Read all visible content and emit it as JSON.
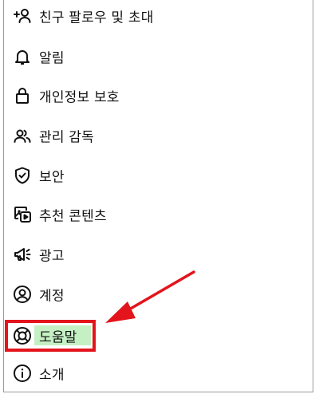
{
  "menu": {
    "items": [
      {
        "label": "친구 팔로우 및 초대",
        "icon": "add-person-icon"
      },
      {
        "label": "알림",
        "icon": "bell-icon"
      },
      {
        "label": "개인정보 보호",
        "icon": "lock-icon"
      },
      {
        "label": "관리 감독",
        "icon": "people-icon"
      },
      {
        "label": "보안",
        "icon": "shield-check-icon"
      },
      {
        "label": "추천 콘텐츠",
        "icon": "media-play-icon"
      },
      {
        "label": "광고",
        "icon": "megaphone-icon"
      },
      {
        "label": "계정",
        "icon": "account-circle-icon"
      },
      {
        "label": "도움말",
        "icon": "lifebuoy-icon",
        "highlighted": true
      },
      {
        "label": "소개",
        "icon": "info-icon"
      }
    ]
  },
  "annotation": {
    "highlight_color": "#e3141c",
    "fill_color": "#c4f0c4",
    "arrow_color": "#e3141c"
  }
}
